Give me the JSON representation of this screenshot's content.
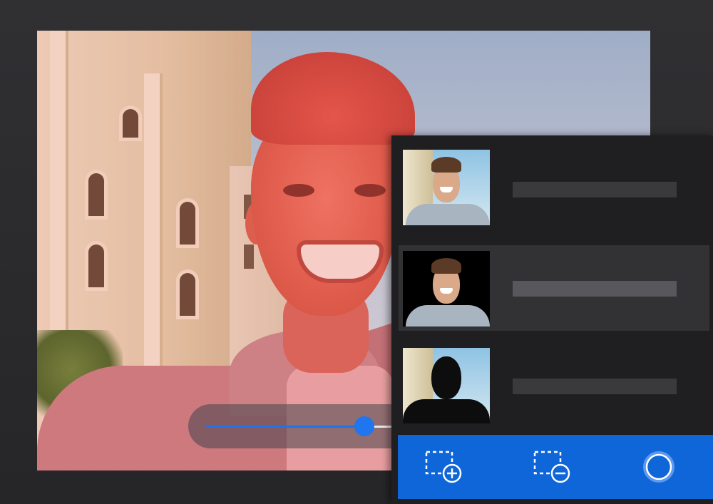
{
  "app": {
    "accent_color": "#0f66d8",
    "panel_color": "#1f1f21",
    "mask_tint_color": "#eb5046"
  },
  "canvas": {
    "mask_overlay": "subject-highlight",
    "slider": {
      "value_percent": 77
    }
  },
  "layers": [
    {
      "thumbnail": "original-photo",
      "selected": false
    },
    {
      "thumbnail": "subject-on-black",
      "selected": true
    },
    {
      "thumbnail": "background-with-silhouette",
      "selected": false
    }
  ],
  "toolbar": {
    "buttons": [
      {
        "icon": "add-selection-icon"
      },
      {
        "icon": "subtract-selection-icon"
      },
      {
        "icon": "brush-circle-icon"
      }
    ]
  }
}
